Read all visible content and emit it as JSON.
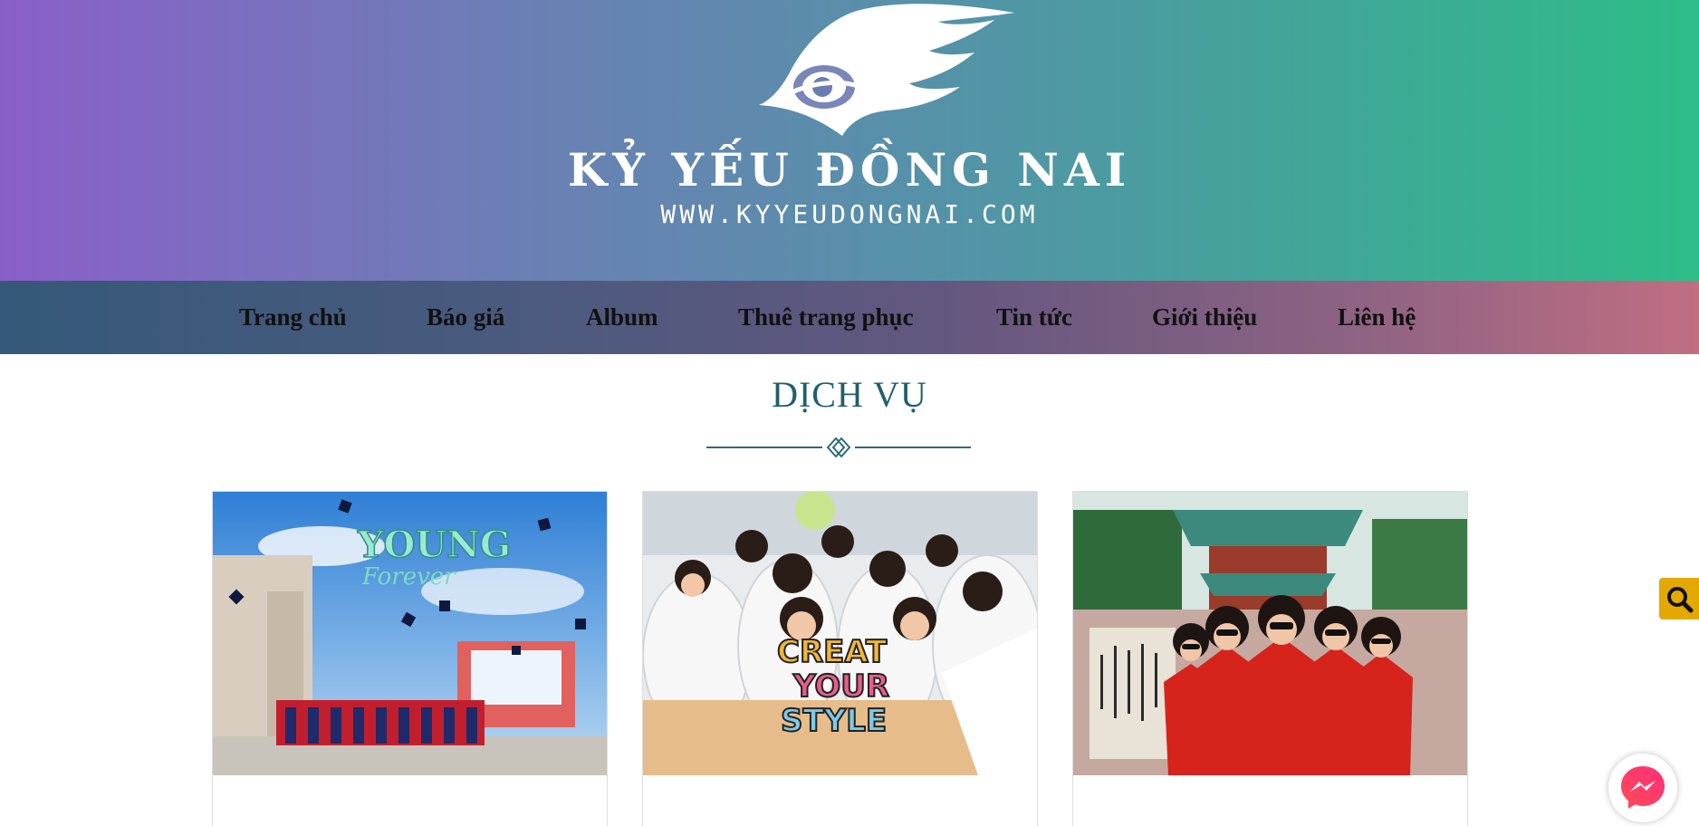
{
  "header": {
    "brand_title": "KỶ YẾU ĐỒNG NAI",
    "brand_url": "WWW.KYYEUDONGNAI.COM",
    "logo_icon": "dragon-eye-logo"
  },
  "nav": {
    "items": [
      {
        "label": "Trang chủ"
      },
      {
        "label": "Báo giá"
      },
      {
        "label": "Album"
      },
      {
        "label": "Thuê trang phục"
      },
      {
        "label": "Tin tức"
      },
      {
        "label": "Giới thiệu"
      },
      {
        "label": "Liên hệ"
      }
    ]
  },
  "services": {
    "title": "DỊCH VỤ",
    "cards": [
      {
        "photo_text_1": "YOUNG",
        "photo_text_2": "Forever",
        "image": "graduation-class-photo"
      },
      {
        "photo_text_1": "CREAT",
        "photo_text_2": "YOUR",
        "photo_text_3": "STYLE",
        "image": "students-ao-dai-photo"
      },
      {
        "image": "red-ao-dai-temple-photo"
      }
    ]
  },
  "floating": {
    "search_icon": "search-icon",
    "messenger_icon": "messenger-icon"
  },
  "colors": {
    "banner_start": "#8a5fc9",
    "banner_end": "#2dbd88",
    "heading": "#1f5f6f",
    "search_button": "#e3a900",
    "messenger": "#ff3d5c"
  }
}
